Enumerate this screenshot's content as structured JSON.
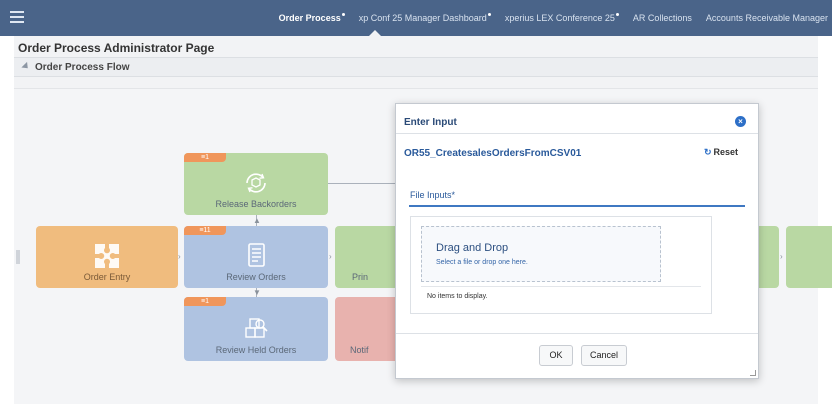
{
  "topbar": {
    "tabs": [
      {
        "label": "Order Process",
        "active": true,
        "dot": true
      },
      {
        "label": "xp Conf 25 Manager Dashboard",
        "active": false,
        "dot": true
      },
      {
        "label": "xperius LEX Conference 25",
        "active": false,
        "dot": true
      },
      {
        "label": "AR Collections",
        "active": false,
        "dot": false
      },
      {
        "label": "Accounts Receivable Manager",
        "active": false,
        "dot": false
      }
    ]
  },
  "page": {
    "title": "Order Process Administrator Page",
    "section_title": "Order Process Flow"
  },
  "flow": {
    "badge_1": "≡1",
    "badge_11": "≡11",
    "badge_held": "≡1",
    "nodes": {
      "order_entry": "Order Entry",
      "release_backorders": "Release Backorders",
      "review_orders": "Review Orders",
      "review_held_orders": "Review Held Orders",
      "print_partial": "Prin",
      "notify_partial": "Notif"
    }
  },
  "modal": {
    "title": "Enter Input",
    "close_icon": "close-icon",
    "process_name": "OR55_CreatesalesOrdersFromCSV01",
    "reset_label": "Reset",
    "section_label": "File Inputs*",
    "dropzone_title": "Drag and Drop",
    "dropzone_subtitle": "Select a file or drop one here.",
    "empty_text": "No items to display.",
    "ok_label": "OK",
    "cancel_label": "Cancel"
  },
  "colors": {
    "topbar": "#4a6489",
    "orange_node": "#f0bc7e",
    "green_node": "#b9d8a3",
    "blue_node": "#afc3e1",
    "red_node": "#e8b2ae",
    "badge": "#f0965b",
    "accent": "#2d6fc7"
  }
}
